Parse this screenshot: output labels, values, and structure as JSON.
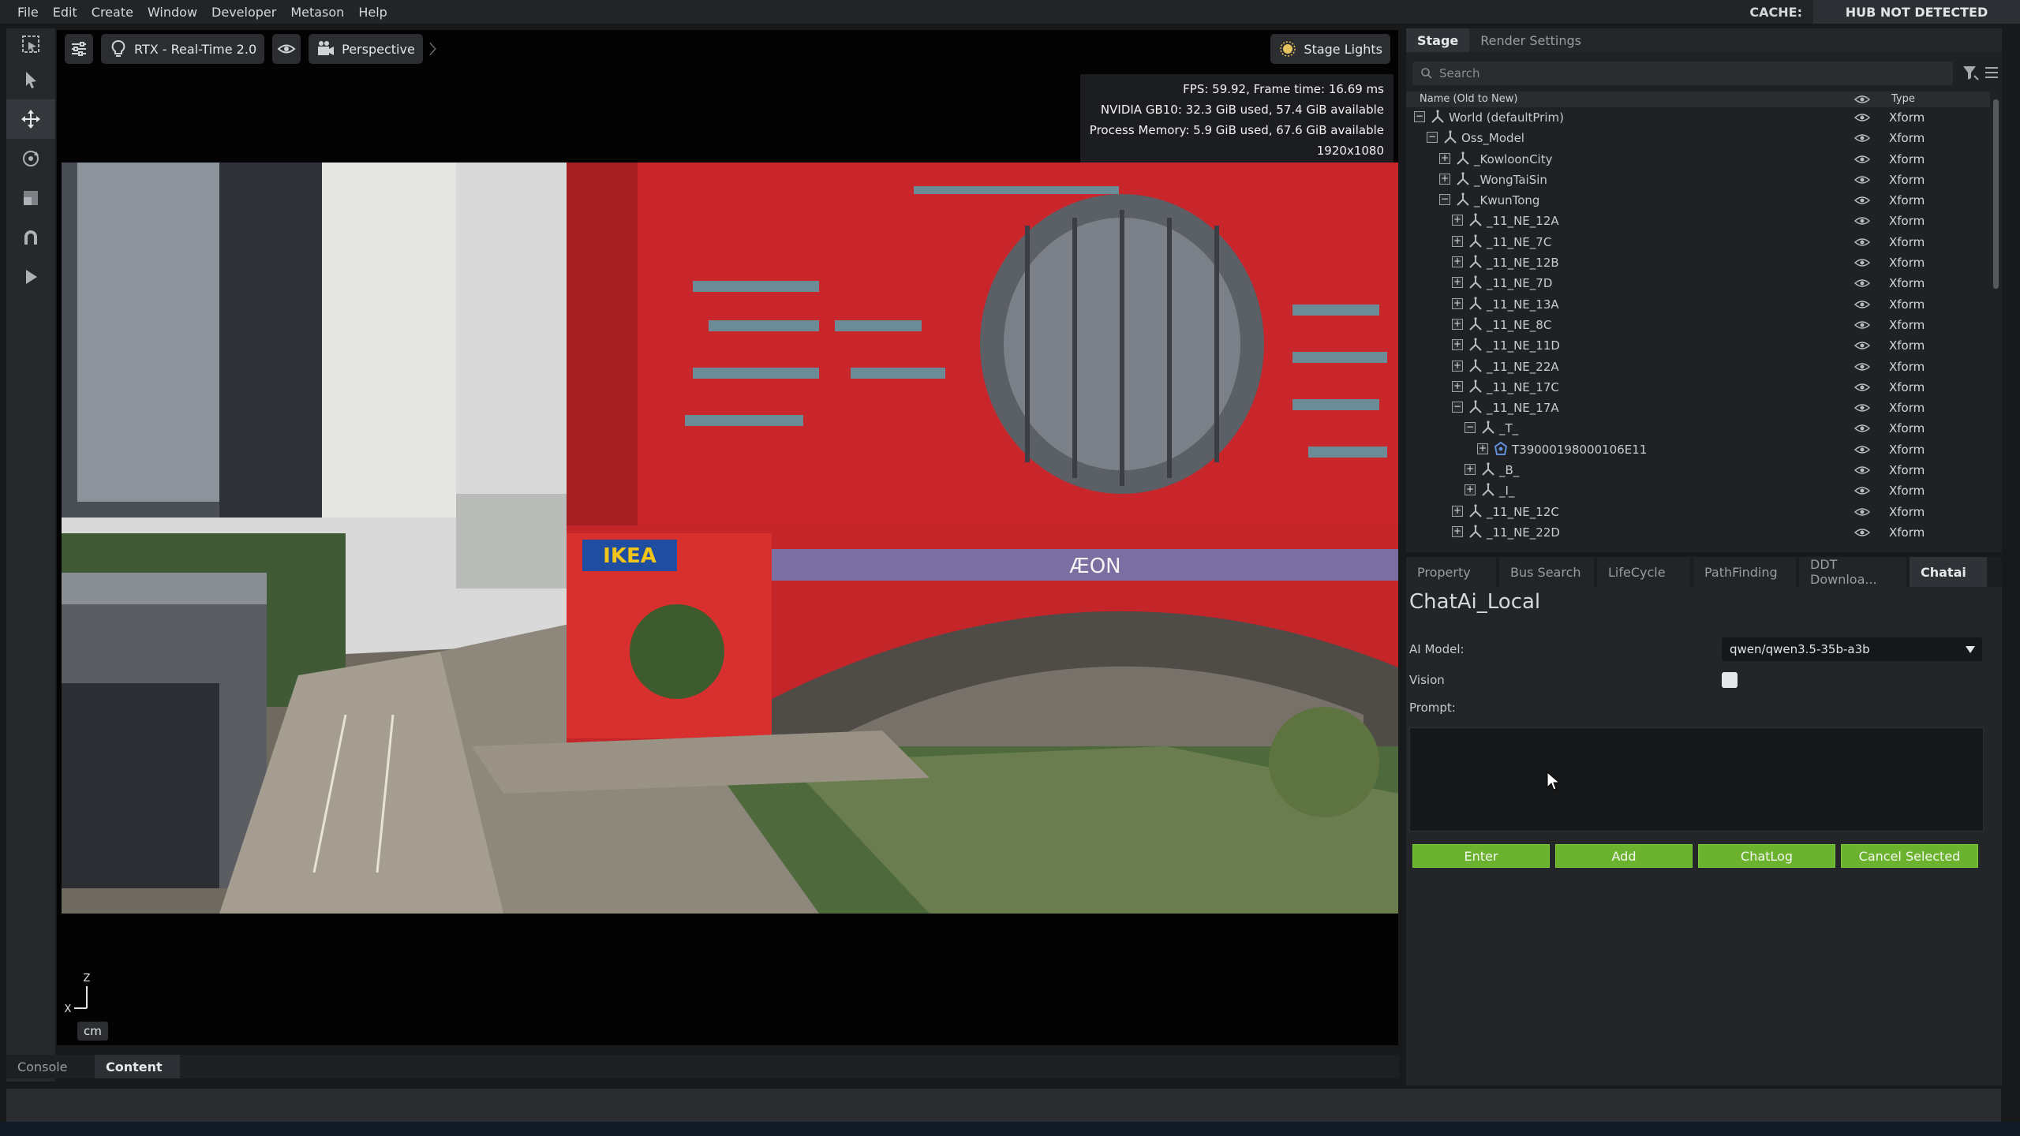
{
  "menubar": {
    "items": [
      "File",
      "Edit",
      "Create",
      "Window",
      "Developer",
      "Metason",
      "Help"
    ],
    "cache_label": "CACHE:",
    "hub_status": "HUB NOT DETECTED"
  },
  "viewport": {
    "render_mode": "RTX - Real-Time 2.0",
    "camera": "Perspective",
    "stage_lights": "Stage Lights",
    "perf": {
      "fps": "FPS: 59.92, Frame time: 16.69 ms",
      "gpu": "NVIDIA GB10: 32.3 GiB used, 57.4 GiB available",
      "memory": "Process Memory: 5.9 GiB used, 67.6 GiB available",
      "resolution": "1920x1080"
    },
    "unit": "cm",
    "axis_z": "Z",
    "axis_x": "X",
    "scene_signs": {
      "ikea": "IKEA",
      "aeon": "ÆON"
    }
  },
  "stage": {
    "tabs": [
      "Stage",
      "Render Settings"
    ],
    "search_placeholder": "Search",
    "col_name": "Name (Old to New)",
    "col_type": "Type",
    "rows": [
      {
        "label": "World (defaultPrim)",
        "type": "Xform",
        "depth": 0,
        "expander": "−"
      },
      {
        "label": "Oss_Model",
        "type": "Xform",
        "depth": 1,
        "expander": "−"
      },
      {
        "label": "_KowloonCity",
        "type": "Xform",
        "depth": 2,
        "expander": "+"
      },
      {
        "label": "_WongTaiSin",
        "type": "Xform",
        "depth": 2,
        "expander": "+"
      },
      {
        "label": "_KwunTong",
        "type": "Xform",
        "depth": 2,
        "expander": "−"
      },
      {
        "label": "_11_NE_12A",
        "type": "Xform",
        "depth": 3,
        "expander": "+"
      },
      {
        "label": "_11_NE_7C",
        "type": "Xform",
        "depth": 3,
        "expander": "+"
      },
      {
        "label": "_11_NE_12B",
        "type": "Xform",
        "depth": 3,
        "expander": "+"
      },
      {
        "label": "_11_NE_7D",
        "type": "Xform",
        "depth": 3,
        "expander": "+"
      },
      {
        "label": "_11_NE_13A",
        "type": "Xform",
        "depth": 3,
        "expander": "+"
      },
      {
        "label": "_11_NE_8C",
        "type": "Xform",
        "depth": 3,
        "expander": "+"
      },
      {
        "label": "_11_NE_11D",
        "type": "Xform",
        "depth": 3,
        "expander": "+"
      },
      {
        "label": "_11_NE_22A",
        "type": "Xform",
        "depth": 3,
        "expander": "+"
      },
      {
        "label": "_11_NE_17C",
        "type": "Xform",
        "depth": 3,
        "expander": "+"
      },
      {
        "label": "_11_NE_17A",
        "type": "Xform",
        "depth": 3,
        "expander": "−"
      },
      {
        "label": "_T_",
        "type": "Xform",
        "depth": 4,
        "expander": "−"
      },
      {
        "label": "T39000198000106E11",
        "type": "Xform",
        "depth": 5,
        "expander": "+",
        "icon": "mesh"
      },
      {
        "label": "_B_",
        "type": "Xform",
        "depth": 4,
        "expander": "+"
      },
      {
        "label": "_I_",
        "type": "Xform",
        "depth": 4,
        "expander": "+"
      },
      {
        "label": "_11_NE_12C",
        "type": "Xform",
        "depth": 3,
        "expander": "+"
      },
      {
        "label": "_11_NE_22D",
        "type": "Xform",
        "depth": 3,
        "expander": "+"
      }
    ]
  },
  "chat": {
    "tabs": [
      "Property",
      "Bus Search",
      "LifeCycle",
      "PathFinding",
      "DDT Downloa...",
      "Chatai"
    ],
    "title": "ChatAi_Local",
    "model_label": "AI Model:",
    "model_value": "qwen/qwen3.5-35b-a3b",
    "vision_label": "Vision",
    "vision_checked": false,
    "prompt_label": "Prompt:",
    "prompt_value": "",
    "buttons": {
      "enter": "Enter",
      "add": "Add",
      "chatlog": "ChatLog",
      "cancel": "Cancel Selected"
    },
    "button_color": "#6bb32e"
  },
  "bottom": {
    "tabs": [
      "Console",
      "Content"
    ]
  },
  "colors": {
    "accent_green": "#6bb32e",
    "building_red": "#c8262b",
    "panel_bg": "#1f2124"
  }
}
